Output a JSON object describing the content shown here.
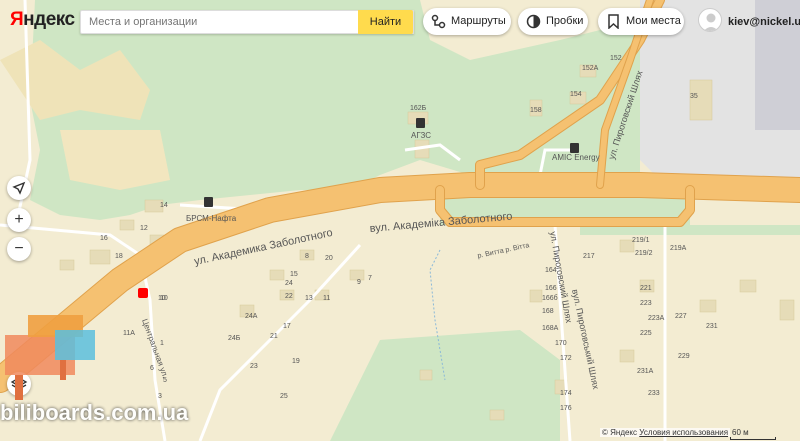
{
  "header": {
    "logo": "Яндекс",
    "search_placeholder": "Места и организации",
    "search_button": "Найти",
    "routes": "Маршруты",
    "traffic": "Пробки",
    "my_places": "Мои места",
    "user": "kiev@nickel.ua"
  },
  "controls": {
    "locate": "◁",
    "zoom_in": "+",
    "zoom_out": "−",
    "layers": "≋"
  },
  "map": {
    "street_main_ru": "ул. Академика Заболотного",
    "street_main_ua": "вул. Академіка Заболотного",
    "street_side_ru": "ул. Пироговский Шлях",
    "street_side_ua": "вул. Пироговський Шлях",
    "street_top": "ул. Пироговский Шлях",
    "street_vitta": "р. Витта р. Вітта",
    "street_tsentr": "Центральная ул.",
    "poi_gas1": "АГЗС",
    "poi_gas2": "БРСМ-Нафта",
    "poi_gas3": "AMIC Energy",
    "house_labels": [
      "162Б",
      "152А",
      "152",
      "154",
      "158",
      "35",
      "14",
      "12",
      "10",
      "16",
      "18",
      "20",
      "22",
      "24",
      "13",
      "11",
      "9",
      "7",
      "8",
      "15",
      "17",
      "19",
      "21",
      "23",
      "25",
      "24А",
      "24Б",
      "11А",
      "10",
      "1",
      "6",
      "5",
      "3",
      "164",
      "166",
      "166б",
      "168",
      "168А",
      "170",
      "172",
      "174",
      "176",
      "217",
      "219/1",
      "219/2",
      "219А",
      "221",
      "223",
      "223А",
      "225",
      "227",
      "231",
      "229",
      "231А",
      "233"
    ]
  },
  "footer": {
    "copyright": "© Яндекс",
    "terms": "Условия использования",
    "scale": "60 м"
  },
  "watermark": "biliboards.com.ua",
  "colors": {
    "road": "#f5c171",
    "road_edge": "#e0a24c",
    "green": "#cfe6c4",
    "land": "#f3ecd2",
    "building": "#e6dcb8",
    "accent": "#ffdb4d",
    "marker": "#ff0000"
  }
}
